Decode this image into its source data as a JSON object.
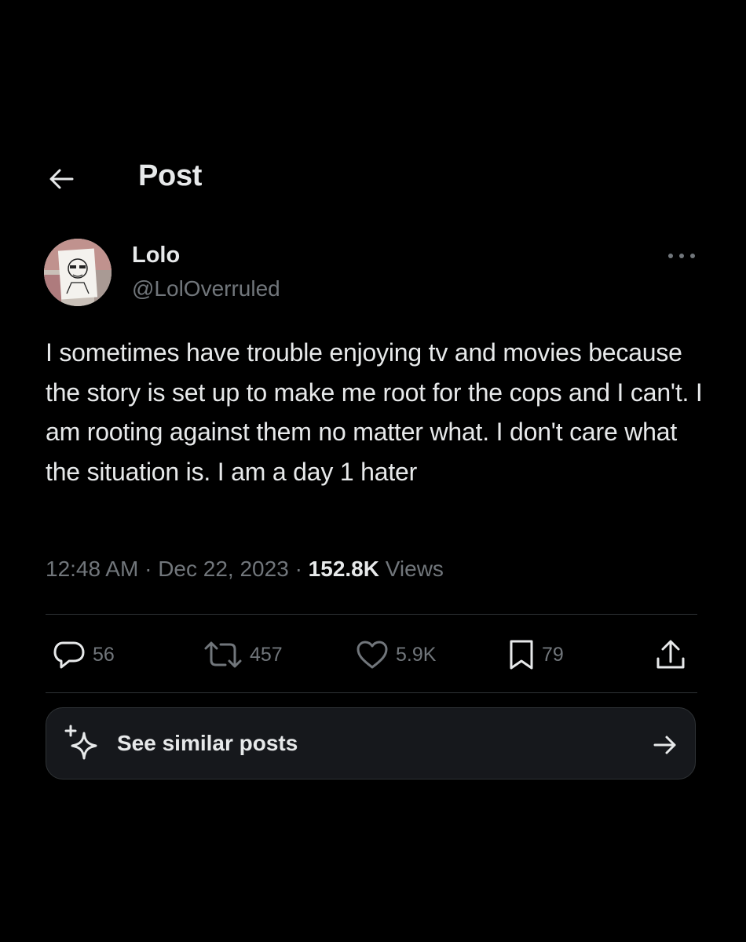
{
  "header": {
    "title": "Post",
    "back_icon": "arrow-left-icon"
  },
  "author": {
    "name": "Lolo",
    "handle": "@LolOverruled",
    "more_icon": "more-horizontal-icon"
  },
  "post": {
    "text": "I sometimes have trouble enjoying tv and movies because the story is set up to make me root for the cops and I can't. I am rooting against them no matter what. I don't care what the situation is. I am a day 1 hater",
    "time": "12:48 AM",
    "separator": "·",
    "date": "Dec 22, 2023",
    "views_count": "152.8K",
    "views_label": "Views"
  },
  "actions": {
    "replies": "56",
    "reposts": "457",
    "likes": "5.9K",
    "bookmarks": "79",
    "icons": [
      "reply-icon",
      "repost-icon",
      "like-icon",
      "bookmark-icon",
      "share-icon"
    ]
  },
  "similar": {
    "label": "See similar posts",
    "icon": "sparkle-icon",
    "arrow_icon": "arrow-right-icon"
  },
  "colors": {
    "background": "#000000",
    "text_primary": "#e7e9ea",
    "text_secondary": "#71767b",
    "divider": "#2f3336",
    "card": "#16181c"
  }
}
